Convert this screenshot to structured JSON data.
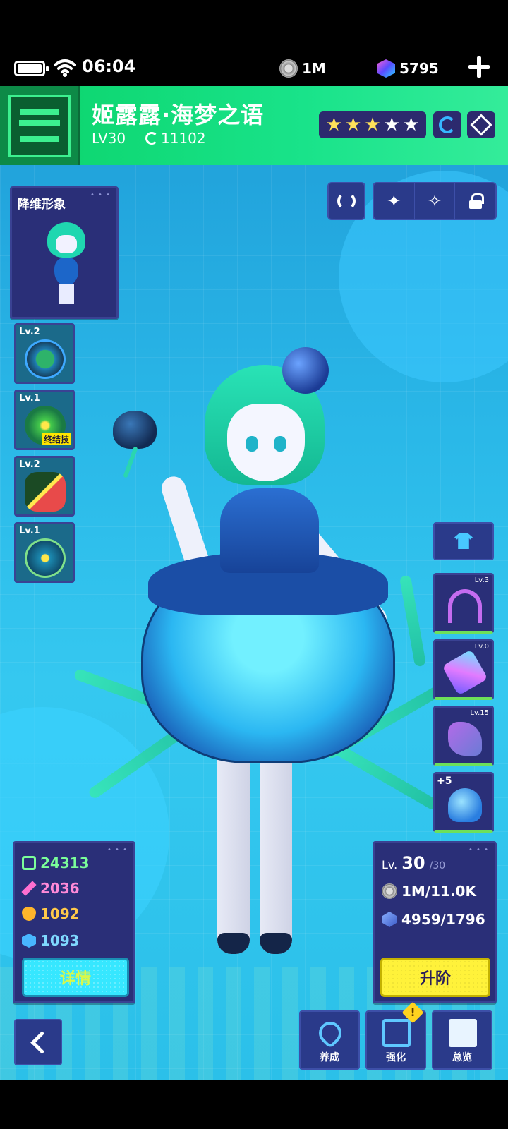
{
  "status_bar": {
    "time": "06:04",
    "battery_level": 1.0,
    "coins": "1M",
    "gems": "5795"
  },
  "header": {
    "character_name": "姬露露·海梦之语",
    "level": "LV30",
    "power": "11102",
    "stars_gold": 3,
    "stars_total": 5,
    "colors": {
      "header_green": "#19e38a",
      "star_gold": "#ffe15a"
    }
  },
  "skin_card": {
    "title": "降维形象"
  },
  "skills": [
    {
      "level": "Lv.2",
      "icon": "leaf-skill-icon"
    },
    {
      "level": "Lv.1",
      "icon": "burst-skill-icon",
      "tag": "终结技"
    },
    {
      "level": "Lv.2",
      "icon": "melon-skill-icon"
    },
    {
      "level": "Lv.1",
      "icon": "locked-skill-icon"
    }
  ],
  "gear": [
    {
      "level": "Lv.3",
      "icon": "headphones-icon"
    },
    {
      "level": "Lv.0",
      "icon": "device-icon"
    },
    {
      "level": "Lv.15",
      "icon": "skate-icon"
    },
    {
      "level": "",
      "icon": "jellyfish-pet-icon",
      "plus": "+5"
    }
  ],
  "stats": {
    "hp": "24313",
    "atk": "2036",
    "def": "1092",
    "spd": "1093",
    "detail_label": "详情"
  },
  "level_panel": {
    "lv_label": "Lv.",
    "lv_current": "30",
    "lv_max": "/30",
    "coin_cost": "1M/11.0K",
    "chip_cost": "4959/1796",
    "ascend_label": "升阶"
  },
  "bottom_nav": {
    "nurture": "养成",
    "enhance": "强化",
    "overview": "总览",
    "alert": "!"
  }
}
